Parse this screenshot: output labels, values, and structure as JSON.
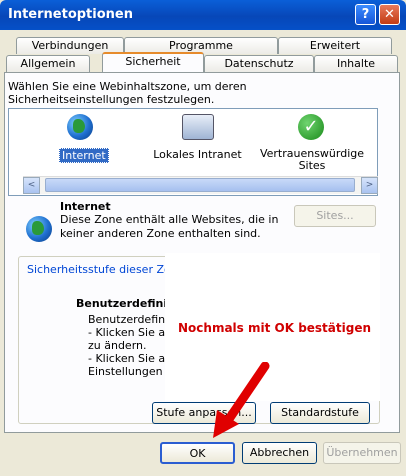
{
  "window": {
    "title": "Internetoptionen",
    "help_glyph": "?",
    "close_glyph": "✕"
  },
  "tabs": {
    "row_back": [
      "Verbindungen",
      "Programme",
      "Erweitert"
    ],
    "row_front": [
      "Allgemein",
      "Sicherheit",
      "Datenschutz",
      "Inhalte"
    ],
    "active": "Sicherheit"
  },
  "zones": {
    "instruction": "Wählen Sie eine Webinhaltszone, um deren Sicherheitseinstellungen festzulegen.",
    "items": [
      {
        "label": "Internet",
        "icon": "globe-icon"
      },
      {
        "label": "Lokales Intranet",
        "icon": "intranet-monitor-icon"
      },
      {
        "label": "Vertrauenswürdige Sites",
        "icon": "trusted-check-icon"
      }
    ],
    "selected": "Internet"
  },
  "scrollbar": {
    "left": "<",
    "right": ">"
  },
  "zone_info": {
    "title": "Internet",
    "description": "Diese Zone enthält alle Websites, die in keiner anderen Zone enthalten sind.",
    "sites_button": "Sites..."
  },
  "security_level": {
    "group_label": "Sicherheitsstufe dieser Zone",
    "heading": "Benutzerdefiniert",
    "text_1": "Benutzerdefinier",
    "text_2": "- Klicken Sie auf",
    "text_3": "zu ändern.",
    "text_4": "- Klicken Sie auf",
    "text_5": "Einstellungen zu",
    "custom_button": "Stufe anpassen...",
    "default_button": "Standardstufe"
  },
  "annotation": {
    "text": "Nochmals mit OK bestätigen",
    "color": "#d00000"
  },
  "footer": {
    "ok": "OK",
    "cancel": "Abbrechen",
    "apply": "Übernehmen"
  },
  "colors": {
    "titlebar": "#0747b8",
    "selected_zone": "#316ac5",
    "active_tab_accent": "#e68b2c"
  }
}
